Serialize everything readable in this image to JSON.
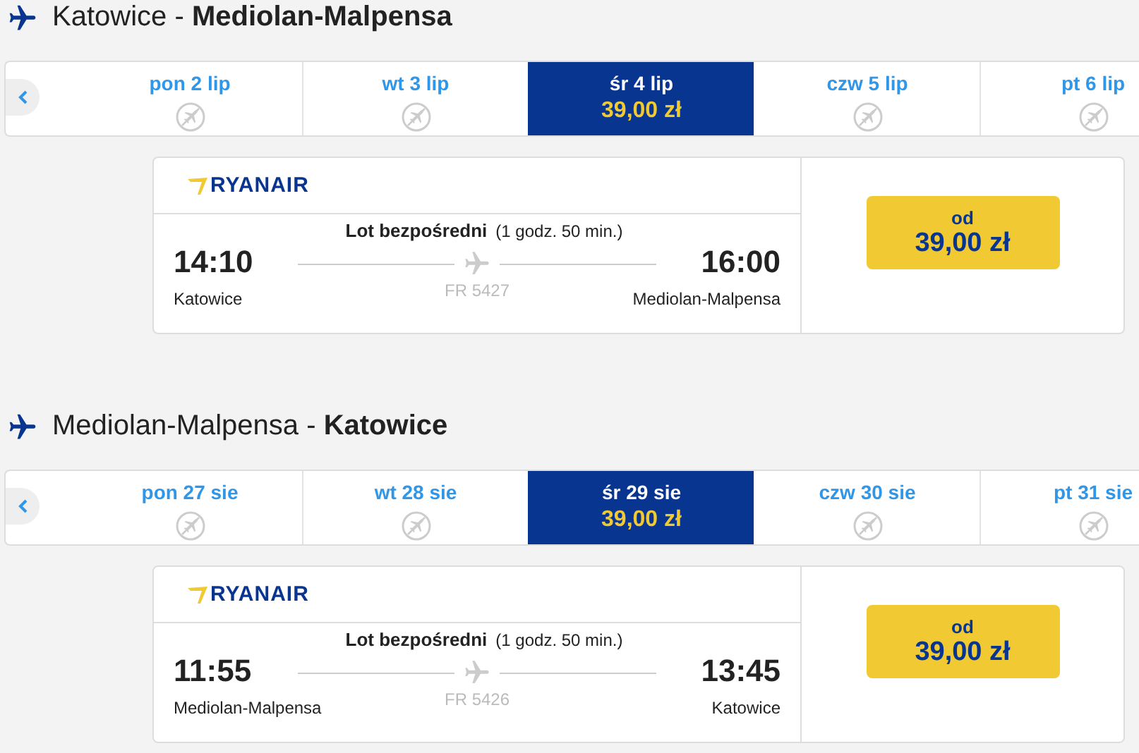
{
  "sections": [
    {
      "route": "Katowice - **Mediolan-Malpensa**",
      "dates": [
        {
          "label": "pon 2 lip",
          "selected": false
        },
        {
          "label": "wt 3 lip",
          "selected": false
        },
        {
          "label": "śr 4 lip",
          "price": "39,00 zł",
          "selected": true
        },
        {
          "label": "czw 5 lip",
          "selected": false
        },
        {
          "label": "pt 6 lip",
          "selected": false
        }
      ],
      "flight": {
        "airline": "RYANAIR",
        "type": "Lot bezpośredni",
        "duration": "(1 godz. 50 min.)",
        "dep_time": "14:10",
        "dep_city": "Katowice",
        "arr_time": "16:00",
        "arr_city": "Mediolan-Malpensa",
        "flight_number": "FR 5427"
      },
      "price_button": {
        "prefix": "od",
        "price": "39,00 zł"
      }
    },
    {
      "route": "Mediolan-Malpensa - **Katowice**",
      "dates": [
        {
          "label": "pon 27 sie",
          "selected": false
        },
        {
          "label": "wt 28 sie",
          "selected": false
        },
        {
          "label": "śr 29 sie",
          "price": "39,00 zł",
          "selected": true
        },
        {
          "label": "czw 30 sie",
          "selected": false
        },
        {
          "label": "pt 31 sie",
          "selected": false
        }
      ],
      "flight": {
        "airline": "RYANAIR",
        "type": "Lot bezpośredni",
        "duration": "(1 godz. 50 min.)",
        "dep_time": "11:55",
        "dep_city": "Mediolan-Malpensa",
        "arr_time": "13:45",
        "arr_city": "Katowice",
        "flight_number": "FR 5426"
      },
      "price_button": {
        "prefix": "od",
        "price": "39,00 zł"
      }
    }
  ]
}
